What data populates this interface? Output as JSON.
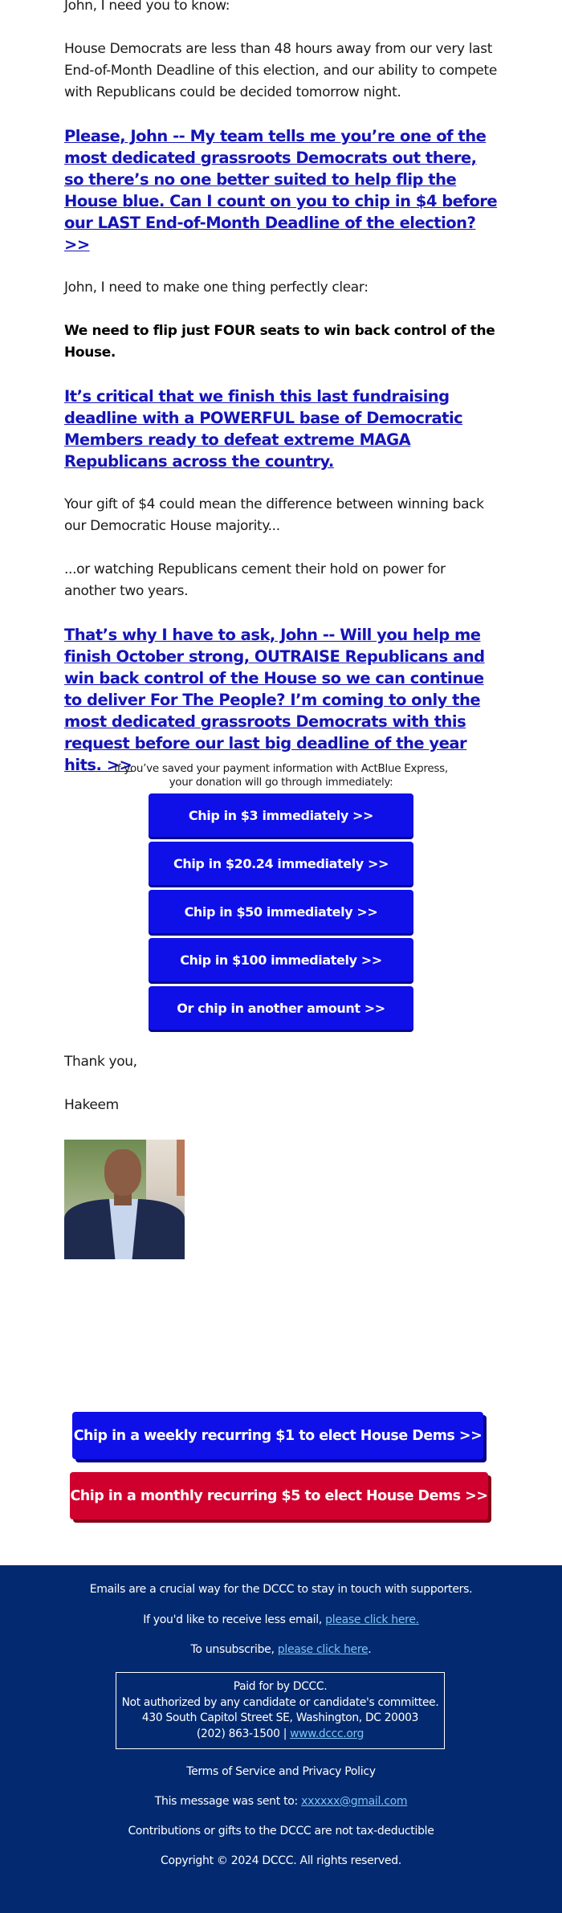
{
  "email": {
    "greeting": "John, I need you to know:",
    "paragraphs": {
      "p1": "House Democrats are less than 48 hours away from our very last End-of-Month Deadline of this election, and our ability to compete with Republicans could be decided tomorrow night.",
      "link1": "Please, John -- My team tells me you’re one of the most dedicated grassroots Democrats out there, so there’s no one better suited to help flip the House blue. Can I count on you to chip in $4 before our LAST End-of-Month Deadline of the election? >>",
      "p2": "John, I need to make one thing perfectly clear:",
      "p3_bold": "We need to flip just FOUR seats to win back control of the House.",
      "link2": "It’s critical that we finish this last fundraising deadline with a POWERFUL base of Democratic Members ready to defeat extreme MAGA Republicans across the country.",
      "p4": "Your gift of $4 could mean the difference between winning back our Democratic House majority...",
      "p5": "...or watching Republicans cement their hold on power for another two years.",
      "link3": "That’s why I have to ask, John -- Will you help me finish October strong, OUTRAISE Republicans and win back control of the House so we can continue to deliver For The People? I’m coming to only the most dedicated grassroots Democrats with this request before our last big deadline of the year hits. >>"
    },
    "express_note_line1": "If you’ve saved your payment information with ActBlue Express,",
    "express_note_line2": "your donation will go through immediately:",
    "chip_buttons": [
      {
        "label": "Chip in $3 immediately >>"
      },
      {
        "label": "Chip in $20.24 immediately >>"
      },
      {
        "label": "Chip in $50 immediately >>"
      },
      {
        "label": "Chip in $100 immediately >>"
      },
      {
        "label": "Or chip in another amount >>"
      }
    ],
    "sign_off": "Thank you,",
    "signature": "Hakeem",
    "photo_alt": "Hakeem Jeffries portrait",
    "recurring": {
      "weekly_label": "Chip in a weekly recurring $1 to elect House Dems >>",
      "monthly_label": "Chip in a monthly recurring $5 to elect House Dems >>"
    }
  },
  "footer": {
    "intro": "Emails are a crucial way for the DCCC to stay in touch with supporters.",
    "less_email_prefix": "If you'd like to receive less email, ",
    "less_email_link": "please click here.",
    "unsubscribe_prefix": "To unsubscribe, ",
    "unsubscribe_link": "please click here",
    "unsubscribe_suffix": ".",
    "disclaimer": {
      "paid_for": "Paid for by DCCC.",
      "not_authorized": "Not authorized by any candidate or candidate's committee.",
      "address": "430 South Capitol Street SE, Washington, DC 20003",
      "phone": "(202) 863-1500 | ",
      "website": "www.dccc.org"
    },
    "terms": "Terms of Service and Privacy Policy",
    "sent_to_prefix": "This message was sent to: ",
    "sent_to_email": "xxxxxx@gmail.com",
    "tax_note": "Contributions or gifts to the DCCC are not tax-deductible",
    "copyright": "Copyright © 2024 DCCC. All rights reserved."
  },
  "colors": {
    "link_blue": "#1414b8",
    "button_blue": "#0f0fe8",
    "button_red": "#d0002e",
    "footer_navy": "#032a70",
    "footer_link": "#7cc4f5"
  }
}
